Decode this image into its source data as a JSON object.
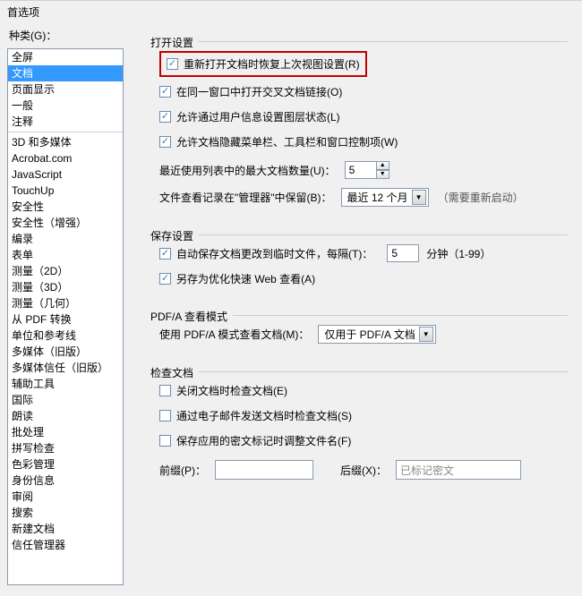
{
  "window": {
    "title": "首选项"
  },
  "category": {
    "label": "种类(G)：",
    "items": [
      "全屏",
      "文档",
      "页面显示",
      "一般",
      "注释",
      "",
      "3D 和多媒体",
      "Acrobat.com",
      "JavaScript",
      "TouchUp",
      "安全性",
      "安全性（增强）",
      "编录",
      "表单",
      "测量（2D）",
      "测量（3D）",
      "测量（几何）",
      "从 PDF 转换",
      "单位和参考线",
      "多媒体（旧版）",
      "多媒体信任（旧版）",
      "辅助工具",
      "国际",
      "朗读",
      "批处理",
      "拼写检查",
      "色彩管理",
      "身份信息",
      "审阅",
      "搜索",
      "新建文档",
      "信任管理器"
    ],
    "selected_index": 1
  },
  "open": {
    "title": "打开设置",
    "restore": "重新打开文档时恢复上次视图设置(R)",
    "crossdoc": "在同一窗口中打开交叉文档链接(O)",
    "layerstate": "允许通过用户信息设置图层状态(L)",
    "hidemenu": "允许文档隐藏菜单栏、工具栏和窗口控制项(W)",
    "recent_label": "最近使用列表中的最大文档数量(U)：",
    "recent_value": "5",
    "history_label": "文件查看记录在\"管理器\"中保留(B)：",
    "history_value": "最近 12 个月",
    "history_hint": "（需要重新启动）"
  },
  "save": {
    "title": "保存设置",
    "autosave": "自动保存文档更改到临时文件，每隔(T)：",
    "autosave_value": "5",
    "autosave_unit": "分钟（1-99）",
    "optimize": "另存为优化快速 Web 查看(A)"
  },
  "pdfa": {
    "title": "PDF/A 查看模式",
    "label": "使用 PDF/A 模式查看文档(M)：",
    "value": "仅用于 PDF/A 文档"
  },
  "inspect": {
    "title": "检查文档",
    "on_close": "关闭文档时检查文档(E)",
    "on_email": "通过电子邮件发送文档时检查文档(S)",
    "redact": "保存应用的密文标记时调整文件名(F)",
    "prefix_label": "前缀(P)：",
    "suffix_label": "后缀(X)：",
    "suffix_placeholder": "已标记密文"
  }
}
